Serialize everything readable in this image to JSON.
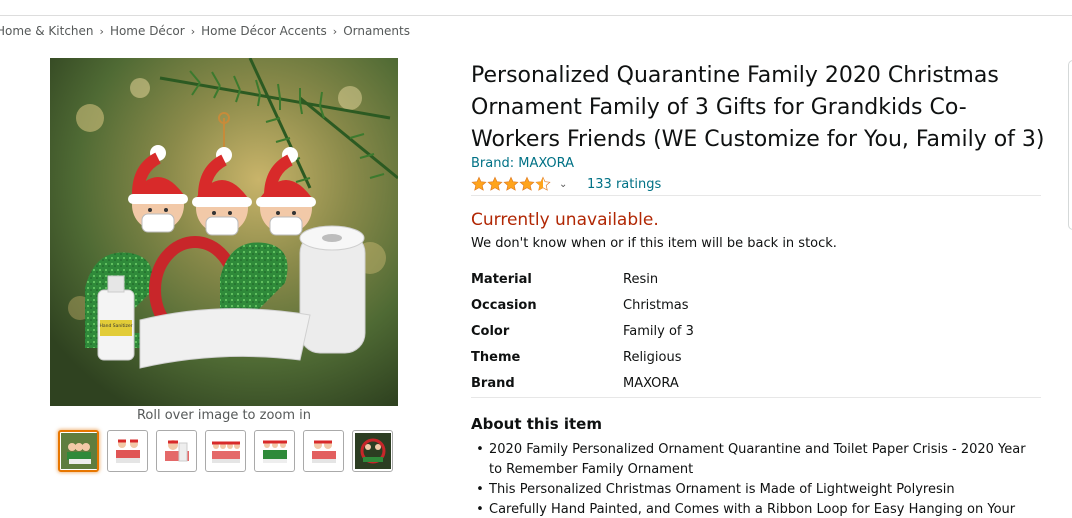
{
  "breadcrumb": {
    "items": [
      "Home & Kitchen",
      "Home Décor",
      "Home Décor Accents",
      "Ornaments"
    ],
    "separator": "›"
  },
  "gallery": {
    "zoom_hint": "Roll over image to zoom in",
    "thumbnail_count": 7,
    "selected_index": 0
  },
  "product": {
    "title": "Personalized Quarantine Family 2020 Christmas Ornament Family of 3 Gifts for Grandkids Co-Workers Friends (WE Customize for You, Family of 3)",
    "brand_link": "Brand: MAXORA",
    "rating": {
      "stars": 4.5,
      "count_text": "133 ratings"
    }
  },
  "availability": {
    "status": "Currently unavailable.",
    "note": "We don't know when or if this item will be back in stock."
  },
  "specs": [
    {
      "label": "Material",
      "value": "Resin"
    },
    {
      "label": "Occasion",
      "value": "Christmas"
    },
    {
      "label": "Color",
      "value": "Family of 3"
    },
    {
      "label": "Theme",
      "value": "Religious"
    },
    {
      "label": "Brand",
      "value": "MAXORA"
    }
  ],
  "about": {
    "heading": "About this item",
    "bullets": [
      "2020 Family Personalized Ornament Quarantine and Toilet Paper Crisis - 2020 Year to Remember Family Ornament",
      "This Personalized Christmas Ornament is Made of Lightweight Polyresin",
      "Carefully Hand Painted, and Comes with a Ribbon Loop for Easy Hanging on Your"
    ]
  },
  "image_text": {
    "sanitizer_label": "Hand Sanitizer"
  },
  "colors": {
    "link": "#007185",
    "unavailable": "#b12704",
    "star": "#ffa41c",
    "selected_thumb": "#e77600"
  }
}
